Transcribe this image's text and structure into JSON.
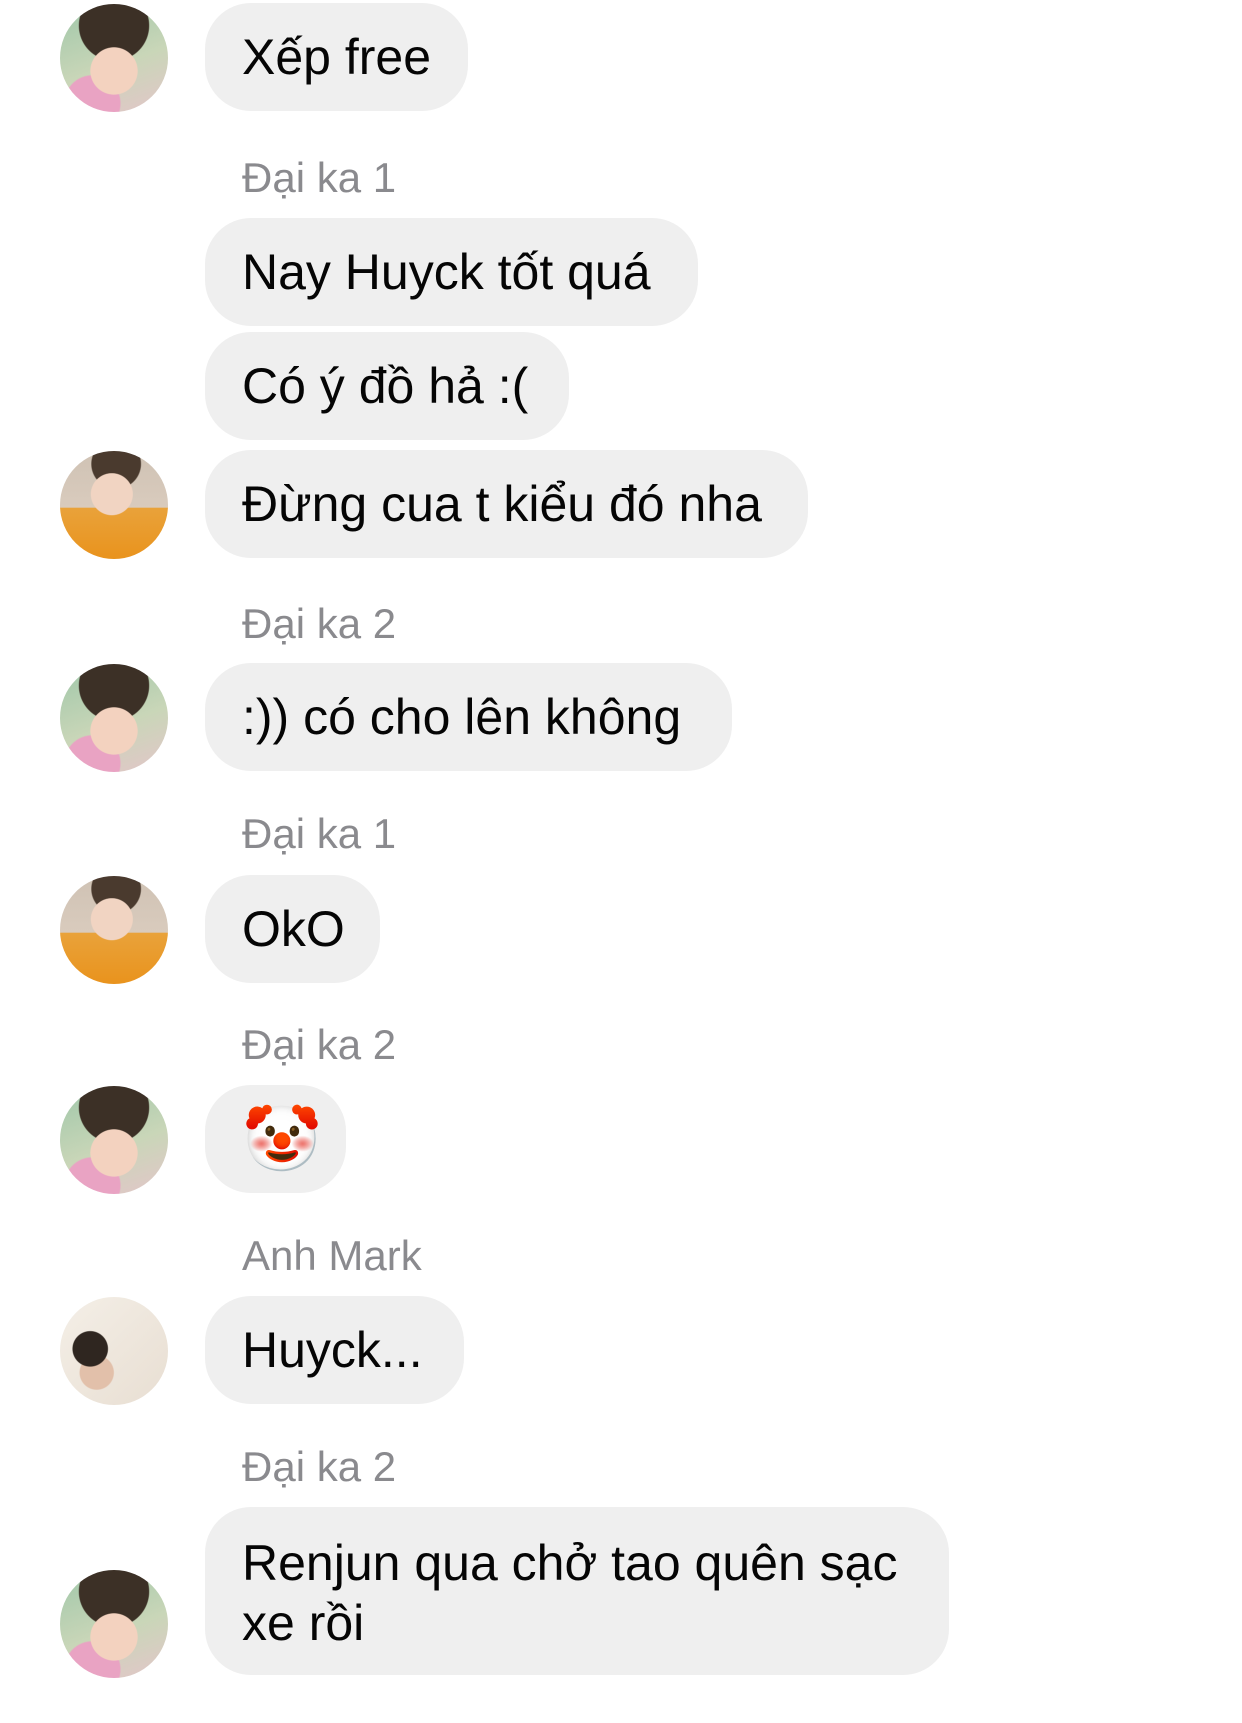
{
  "messages": [
    {
      "text": "Xếp free"
    },
    {
      "sender": "Đại ka 1"
    },
    {
      "text": "Nay Huyck tốt quá"
    },
    {
      "text": "Có ý đồ hả :("
    },
    {
      "text": "Đừng cua t kiểu đó nha"
    },
    {
      "sender": "Đại ka 2"
    },
    {
      "text": ":)) có cho lên không"
    },
    {
      "sender": "Đại ka 1"
    },
    {
      "text": "OkO"
    },
    {
      "sender": "Đại ka 2"
    },
    {
      "text": "🤡"
    },
    {
      "sender": "Anh Mark"
    },
    {
      "text": "Huyck..."
    },
    {
      "sender": "Đại ka 2"
    },
    {
      "text": "Renjun qua chở tao quên sạc xe rồi"
    }
  ],
  "avatars": [
    {
      "icon": "avatar-dai-ka-2"
    },
    {
      "icon": "avatar-dai-ka-1"
    },
    {
      "icon": "avatar-dai-ka-2"
    },
    {
      "icon": "avatar-dai-ka-1"
    },
    {
      "icon": "avatar-dai-ka-2"
    },
    {
      "icon": "avatar-anh-mark"
    },
    {
      "icon": "avatar-dai-ka-2"
    }
  ],
  "colors": {
    "bubble": "#efefef",
    "text": "#050505",
    "sender": "#8a8a8e",
    "background": "#ffffff"
  }
}
